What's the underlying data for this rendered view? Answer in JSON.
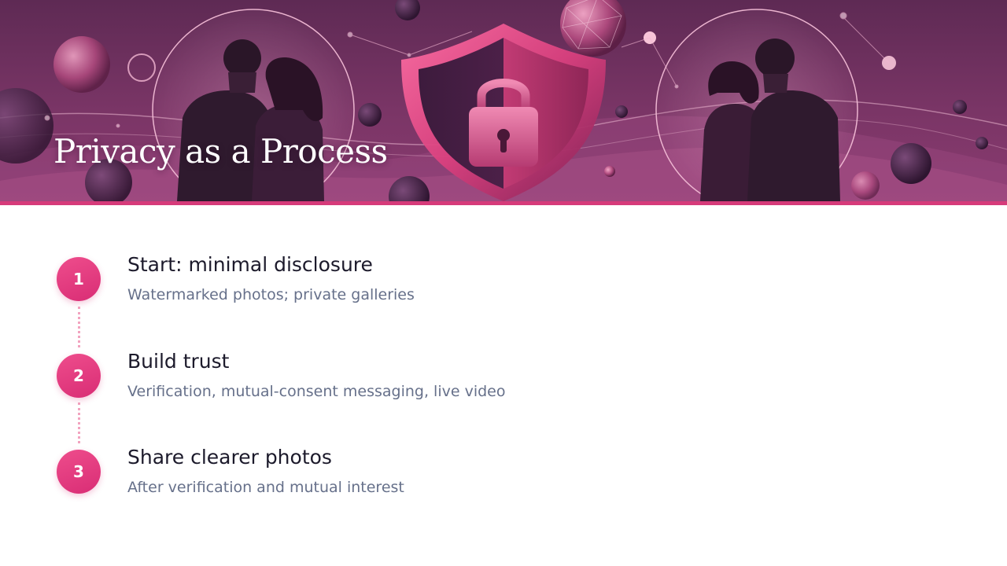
{
  "slide": {
    "title": "Privacy as a Process"
  },
  "theme": {
    "accent": "#d63b7a",
    "step_circle": "#e63d82",
    "title_text": "#1c1a2b",
    "desc_text": "#66708a",
    "hero_bg": "#6e3060"
  },
  "hero": {
    "icons": [
      "shield-icon",
      "padlock-icon",
      "couple-left-illustration",
      "couple-right-illustration",
      "geodesic-sphere-icon"
    ]
  },
  "steps": [
    {
      "number": "1",
      "title": "Start: minimal disclosure",
      "description": "Watermarked photos; private galleries"
    },
    {
      "number": "2",
      "title": "Build trust",
      "description": "Verification, mutual-consent messaging, live video"
    },
    {
      "number": "3",
      "title": "Share clearer photos",
      "description": "After verification and mutual interest"
    }
  ]
}
